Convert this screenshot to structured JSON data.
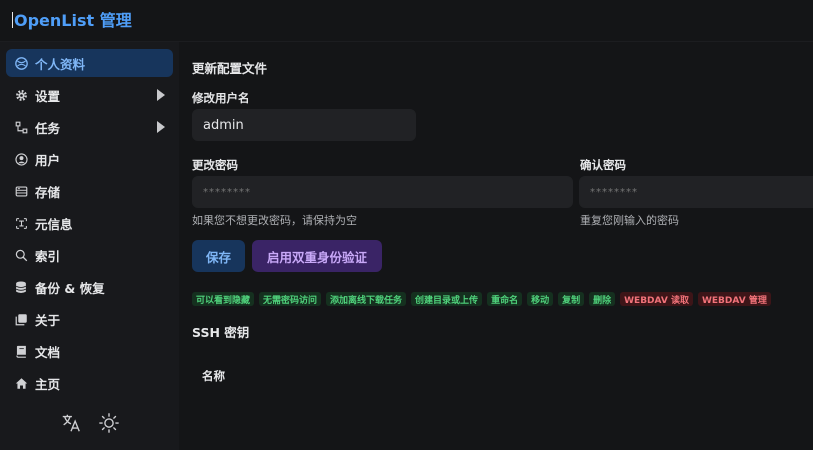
{
  "header": {
    "title": "OpenList 管理"
  },
  "sidebar": {
    "items": [
      {
        "label": "个人资料",
        "icon": "profile-icon",
        "active": true
      },
      {
        "label": "设置",
        "icon": "gear-icon",
        "expandable": true
      },
      {
        "label": "任务",
        "icon": "task-icon",
        "expandable": true
      },
      {
        "label": "用户",
        "icon": "user-icon"
      },
      {
        "label": "存储",
        "icon": "storage-icon"
      },
      {
        "label": "元信息",
        "icon": "meta-icon"
      },
      {
        "label": "索引",
        "icon": "search-icon"
      },
      {
        "label": "备份 & 恢复",
        "icon": "database-icon"
      },
      {
        "label": "关于",
        "icon": "about-icon"
      },
      {
        "label": "文档",
        "icon": "book-icon"
      },
      {
        "label": "主页",
        "icon": "home-icon"
      }
    ],
    "footer_icons": [
      "translate-icon",
      "sun-icon"
    ]
  },
  "profile": {
    "section_title": "更新配置文件",
    "username_label": "修改用户名",
    "username_value": "admin",
    "password_label": "更改密码",
    "password_placeholder": "********",
    "password_hint": "如果您不想更改密码，请保持为空",
    "confirm_label": "确认密码",
    "confirm_placeholder": "********",
    "confirm_hint": "重复您刚输入的密码",
    "save_label": "保存",
    "twofa_label": "启用双重身份验证"
  },
  "permissions": [
    {
      "label": "可以看到隐藏",
      "granted": true
    },
    {
      "label": "无需密码访问",
      "granted": true
    },
    {
      "label": "添加离线下载任务",
      "granted": true
    },
    {
      "label": "创建目录或上传",
      "granted": true
    },
    {
      "label": "重命名",
      "granted": true
    },
    {
      "label": "移动",
      "granted": true
    },
    {
      "label": "复制",
      "granted": true
    },
    {
      "label": "删除",
      "granted": true
    },
    {
      "label": "WEBDAV 读取",
      "granted": false
    },
    {
      "label": "WEBDAV 管理",
      "granted": false
    }
  ],
  "ssh": {
    "section_title": "SSH 密钥",
    "column_name": "名称"
  },
  "colors": {
    "accent": "#4f9ef8",
    "active_bg": "#17355c",
    "granted": "#4fd17b",
    "denied": "#f2737a"
  }
}
